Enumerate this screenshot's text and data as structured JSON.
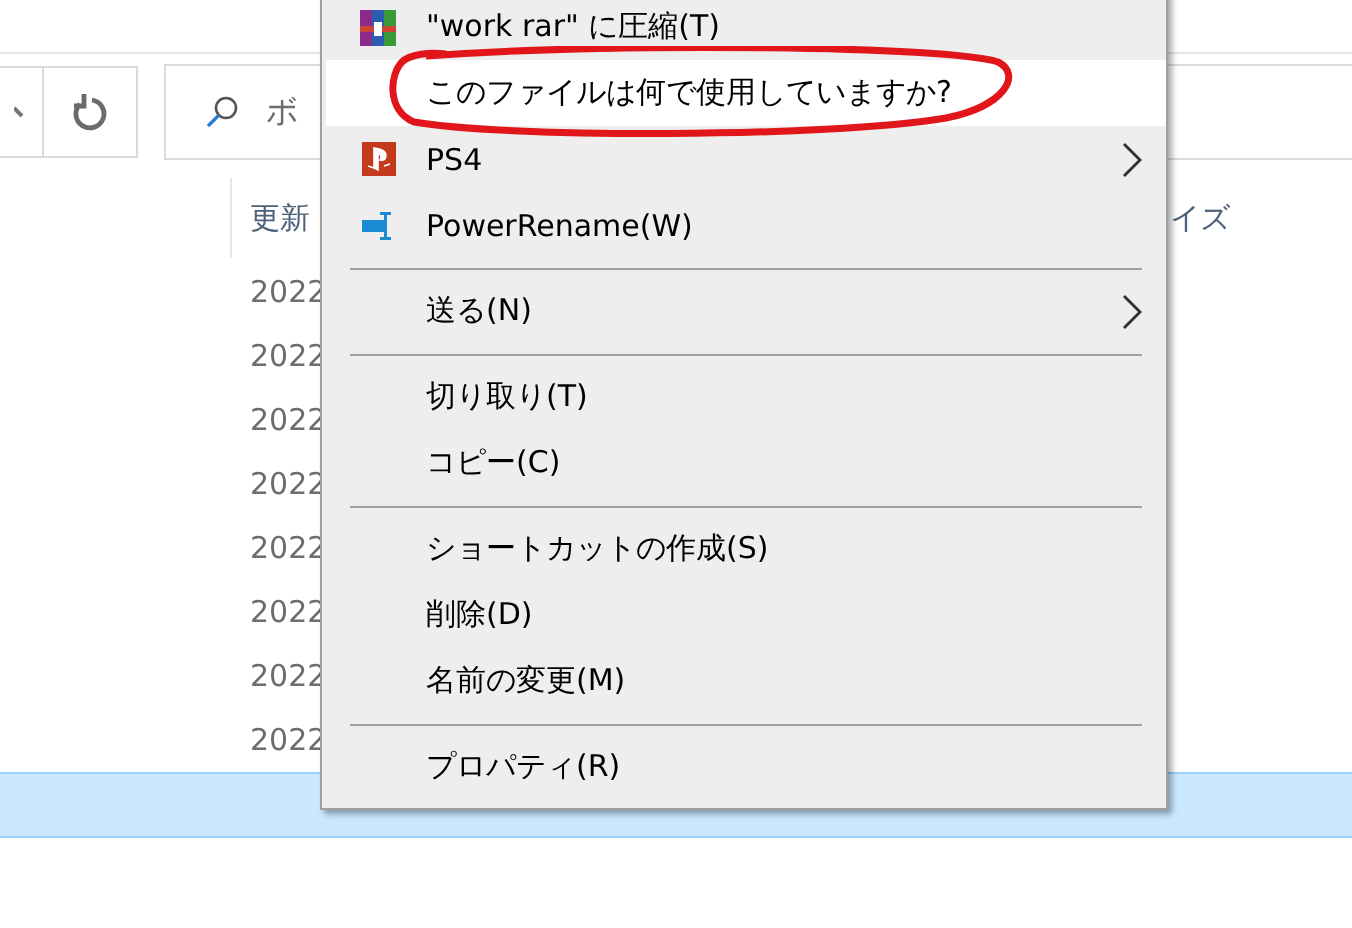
{
  "toolbar": {
    "search": {
      "placeholder": "ボ"
    }
  },
  "file_list": {
    "columns": [
      {
        "label": "更新"
      },
      {
        "label": "イズ"
      }
    ],
    "rows": [
      {
        "date": "2022",
        "selected": false
      },
      {
        "date": "2022",
        "selected": false
      },
      {
        "date": "2022",
        "selected": false
      },
      {
        "date": "2022",
        "selected": false
      },
      {
        "date": "2022",
        "selected": false
      },
      {
        "date": "2022",
        "selected": false
      },
      {
        "date": "2022",
        "selected": false
      },
      {
        "date": "2022",
        "selected": false
      },
      {
        "selected": true
      }
    ]
  },
  "context_menu": {
    "items": [
      {
        "kind": "item",
        "label": "\"work rar\" に圧縮(T)",
        "submenu": false,
        "highlighted": false
      },
      {
        "kind": "item",
        "label": "このファイルは何で使用していますか?",
        "submenu": false,
        "highlighted": true
      },
      {
        "kind": "item",
        "label": "PS4",
        "submenu": true,
        "highlighted": false
      },
      {
        "kind": "item",
        "label": "PowerRename(W)",
        "submenu": false,
        "highlighted": false
      },
      {
        "kind": "separator"
      },
      {
        "kind": "item",
        "label": "送る(N)",
        "submenu": true,
        "highlighted": false
      },
      {
        "kind": "separator"
      },
      {
        "kind": "item",
        "label": "切り取り(T)",
        "submenu": false,
        "highlighted": false
      },
      {
        "kind": "item",
        "label": "コピー(C)",
        "submenu": false,
        "highlighted": false
      },
      {
        "kind": "separator"
      },
      {
        "kind": "item",
        "label": "ショートカットの作成(S)",
        "submenu": false,
        "highlighted": false
      },
      {
        "kind": "item",
        "label": "削除(D)",
        "submenu": false,
        "highlighted": false
      },
      {
        "kind": "item",
        "label": "名前の変更(M)",
        "submenu": false,
        "highlighted": false
      },
      {
        "kind": "separator"
      },
      {
        "kind": "item",
        "label": "プロパティ(R)",
        "submenu": false,
        "highlighted": false
      }
    ]
  }
}
